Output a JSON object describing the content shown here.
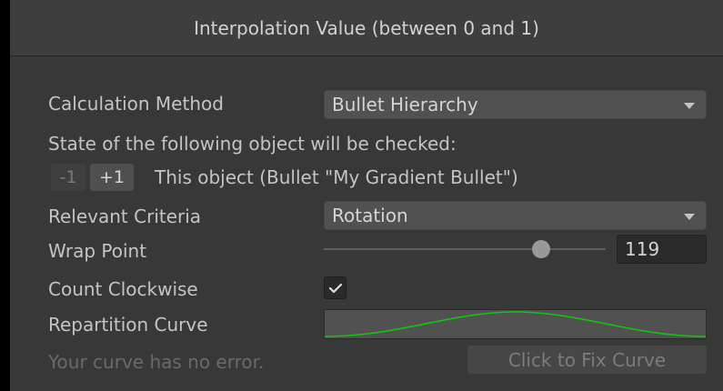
{
  "header": {
    "title": "Interpolation Value (between 0 and 1)"
  },
  "calculation_method": {
    "label": "Calculation Method",
    "value": "Bullet Hierarchy"
  },
  "hierarchy": {
    "info": "State of the following object will be checked:",
    "minus_label": "-1",
    "plus_label": "+1",
    "object_text": "This object (Bullet \"My Gradient Bullet\")"
  },
  "relevant_criteria": {
    "label": "Relevant Criteria",
    "value": "Rotation"
  },
  "wrap_point": {
    "label": "Wrap Point",
    "value": "119",
    "slider_fraction": 0.77
  },
  "count_clockwise": {
    "label": "Count Clockwise",
    "checked": true
  },
  "repartition_curve": {
    "label": "Repartition Curve",
    "curve_color": "#12c512"
  },
  "footer": {
    "status": "Your curve has no error.",
    "fix_button": "Click to Fix Curve"
  },
  "icons": {
    "dropdown": "chevron-down-icon",
    "check": "checkmark-icon"
  }
}
